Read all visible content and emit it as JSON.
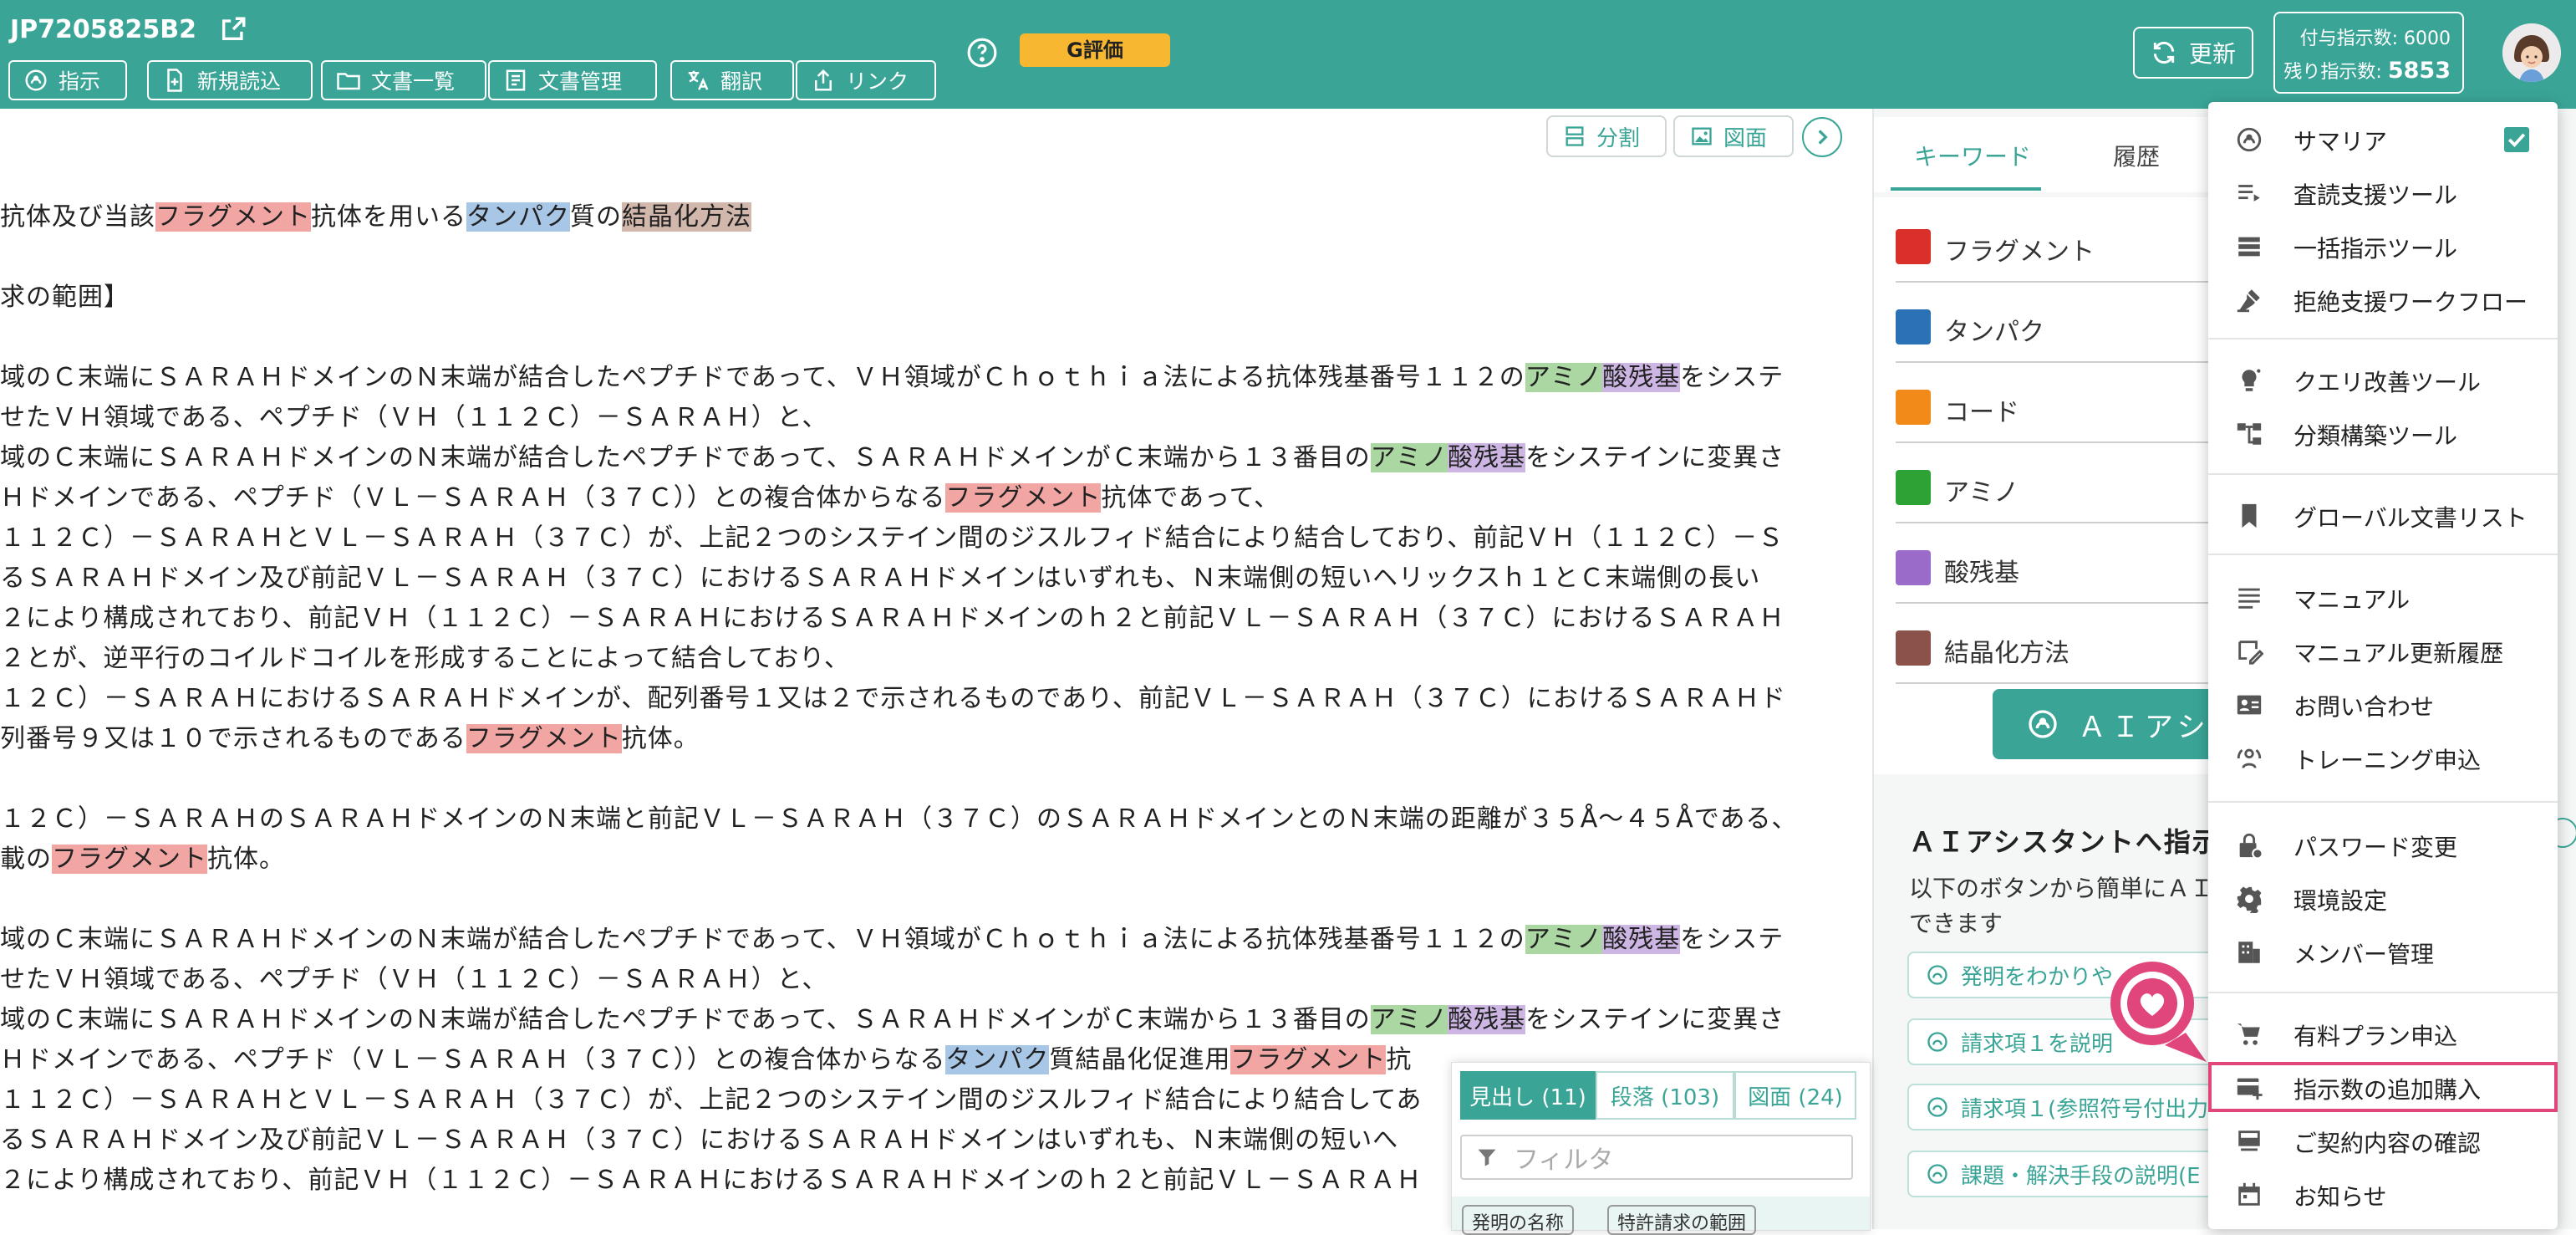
{
  "header": {
    "patent_id": "JP7205825B2",
    "toolbar": {
      "instruct": "指示",
      "new_read": "新規読込",
      "doc_list": "文書一覧",
      "doc_manage": "文書管理",
      "translate": "翻訳",
      "link": "リンク"
    },
    "evaluation_badge": "G評価",
    "update": "更新",
    "quota": {
      "granted_label": "付与指示数: 6000",
      "remaining_label": "残り指示数:",
      "remaining_value": "5853"
    }
  },
  "doc_controls": {
    "split": "分割",
    "figure": "図面"
  },
  "document": {
    "title_line": [
      {
        "t": "抗体及び当該",
        "h": ""
      },
      {
        "t": "フラグメント",
        "h": "frag"
      },
      {
        "t": "抗体を用いる",
        "h": ""
      },
      {
        "t": "タンパク",
        "h": "prot"
      },
      {
        "t": "質の",
        "h": ""
      },
      {
        "t": "結晶化方法",
        "h": "cryst"
      }
    ],
    "claims_heading": "求の範囲】",
    "para1": [
      [
        {
          "t": "域のＣ末端にＳＡＲＡＨドメインのＮ末端が結合したペプチドであって、ＶＨ領域がＣｈｏｔｈｉａ法による抗体残基番号１１２の",
          "h": ""
        },
        {
          "t": "アミノ",
          "h": "amino"
        },
        {
          "t": "酸残基",
          "h": "res"
        },
        {
          "t": "をシステ",
          "h": ""
        }
      ],
      [
        {
          "t": "せたＶＨ領域である、ペプチド（ＶＨ（１１２Ｃ）－ＳＡＲＡＨ）と、",
          "h": ""
        }
      ],
      [
        {
          "t": "域のＣ末端にＳＡＲＡＨドメインのＮ末端が結合したペプチドであって、ＳＡＲＡＨドメインがＣ末端から１３番目の",
          "h": ""
        },
        {
          "t": "アミノ",
          "h": "amino"
        },
        {
          "t": "酸残基",
          "h": "res"
        },
        {
          "t": "をシステインに変異さ",
          "h": ""
        }
      ],
      [
        {
          "t": "Ｈドメインである、ペプチド（ＶＬ－ＳＡＲＡＨ（３７Ｃ））との複合体からなる",
          "h": ""
        },
        {
          "t": "フラグメント",
          "h": "frag"
        },
        {
          "t": "抗体であって、",
          "h": ""
        }
      ],
      [
        {
          "t": "１１２Ｃ）－ＳＡＲＡＨとＶＬ－ＳＡＲＡＨ（３７Ｃ）が、上記２つのシステイン間のジスルフィド結合により結合しており、前記ＶＨ（１１２Ｃ）－Ｓ",
          "h": ""
        }
      ],
      [
        {
          "t": "るＳＡＲＡＨドメイン及び前記ＶＬ－ＳＡＲＡＨ（３７Ｃ）におけるＳＡＲＡＨドメインはいずれも、Ｎ末端側の短いヘリックスｈ１とＣ末端側の長い",
          "h": ""
        }
      ],
      [
        {
          "t": "２により構成されており、前記ＶＨ（１１２Ｃ）－ＳＡＲＡＨにおけるＳＡＲＡＨドメインのｈ２と前記ＶＬ－ＳＡＲＡＨ（３７Ｃ）におけるＳＡＲＡＨ",
          "h": ""
        }
      ],
      [
        {
          "t": "２とが、逆平行のコイルドコイルを形成することによって結合しており、",
          "h": ""
        }
      ],
      [
        {
          "t": "１２Ｃ）－ＳＡＲＡＨにおけるＳＡＲＡＨドメインが、配列番号１又は２で示されるものであり、前記ＶＬ－ＳＡＲＡＨ（３７Ｃ）におけるＳＡＲＡＨド",
          "h": ""
        }
      ],
      [
        {
          "t": "列番号９又は１０で示されるものである",
          "h": ""
        },
        {
          "t": "フラグメント",
          "h": "frag"
        },
        {
          "t": "抗体。",
          "h": ""
        }
      ]
    ],
    "para2": [
      [
        {
          "t": "１２Ｃ）－ＳＡＲＡＨのＳＡＲＡＨドメインのＮ末端と前記ＶＬ－ＳＡＲＡＨ（３７Ｃ）のＳＡＲＡＨドメインとのＮ末端の距離が３５Å～４５Åである、",
          "h": ""
        }
      ],
      [
        {
          "t": "載の",
          "h": ""
        },
        {
          "t": "フラグメント",
          "h": "frag"
        },
        {
          "t": "抗体。",
          "h": ""
        }
      ]
    ],
    "para3": [
      [
        {
          "t": "域のＣ末端にＳＡＲＡＨドメインのＮ末端が結合したペプチドであって、ＶＨ領域がＣｈｏｔｈｉａ法による抗体残基番号１１２の",
          "h": ""
        },
        {
          "t": "アミノ",
          "h": "amino"
        },
        {
          "t": "酸残基",
          "h": "res"
        },
        {
          "t": "をシステ",
          "h": ""
        }
      ],
      [
        {
          "t": "せたＶＨ領域である、ペプチド（ＶＨ（１１２Ｃ）－ＳＡＲＡＨ）と、",
          "h": ""
        }
      ],
      [
        {
          "t": "域のＣ末端にＳＡＲＡＨドメインのＮ末端が結合したペプチドであって、ＳＡＲＡＨドメインがＣ末端から１３番目の",
          "h": ""
        },
        {
          "t": "アミノ",
          "h": "amino"
        },
        {
          "t": "酸残基",
          "h": "res"
        },
        {
          "t": "をシステインに変異さ",
          "h": ""
        }
      ],
      [
        {
          "t": "Ｈドメインである、ペプチド（ＶＬ－ＳＡＲＡＨ（３７Ｃ））との複合体からなる",
          "h": ""
        },
        {
          "t": "タンパク",
          "h": "prot"
        },
        {
          "t": "質結晶化促進用",
          "h": ""
        },
        {
          "t": "フラグメント",
          "h": "frag"
        },
        {
          "t": "抗",
          "h": ""
        }
      ],
      [
        {
          "t": "１１２Ｃ）－ＳＡＲＡＨとＶＬ－ＳＡＲＡＨ（３７Ｃ）が、上記２つのシステイン間のジスルフィド結合により結合してあ",
          "h": ""
        }
      ],
      [
        {
          "t": "るＳＡＲＡＨドメイン及び前記ＶＬ－ＳＡＲＡＨ（３７Ｃ）におけるＳＡＲＡＨドメインはいずれも、Ｎ末端側の短いへ",
          "h": ""
        }
      ],
      [
        {
          "t": "２により構成されており、前記ＶＨ（１１２Ｃ）－ＳＡＲＡＨにおけるＳＡＲＡＨドメインのｈ２と前記ＶＬ－ＳＡＲＡＨ",
          "h": ""
        }
      ]
    ]
  },
  "right_panel": {
    "tabs": [
      "キーワード",
      "履歴"
    ],
    "keywords": [
      {
        "label": "フラグメント",
        "color": "#d9302a"
      },
      {
        "label": "タンパク",
        "color": "#2a72b5"
      },
      {
        "label": "コード",
        "color": "#f28a1a"
      },
      {
        "label": "アミノ",
        "color": "#2ca334"
      },
      {
        "label": "酸残基",
        "color": "#9b6bc9"
      },
      {
        "label": "結晶化方法",
        "color": "#8a5248"
      }
    ],
    "ai_button": "ＡＩアシス",
    "ai_section_title": "ＡＩアシスタントへ指示",
    "ai_section_desc": "以下のボタンから簡単にＡＩ　できます",
    "ai_chips": [
      "発明をわかりや",
      "請求項１を説明",
      "請求項１(参照符号付出力",
      "課題・解決手段の説明(E"
    ]
  },
  "outline": {
    "tabs": [
      "見出し (11)",
      "段落 (103)",
      "図面 (24)"
    ],
    "filter_placeholder": "フィルタ",
    "tags": [
      "発明の名称",
      "特許請求の範囲"
    ]
  },
  "menu": {
    "group1": [
      "サマリア",
      "査読支援ツール",
      "一括指示ツール",
      "拒絶支援ワークフロー"
    ],
    "group2": [
      "クエリ改善ツール",
      "分類構築ツール"
    ],
    "group3": [
      "グローバル文書リスト"
    ],
    "group4": [
      "マニュアル",
      "マニュアル更新履歴",
      "お問い合わせ",
      "トレーニング申込"
    ],
    "group5": [
      "パスワード変更",
      "環境設定",
      "メンバー管理"
    ],
    "group6": [
      "有料プラン申込",
      "指示数の追加購入",
      "ご契約内容の確認",
      "お知らせ"
    ]
  },
  "colors": {
    "brand": "#3aa597",
    "badge": "#f7b731",
    "highlight_menu": "#e0457b"
  }
}
